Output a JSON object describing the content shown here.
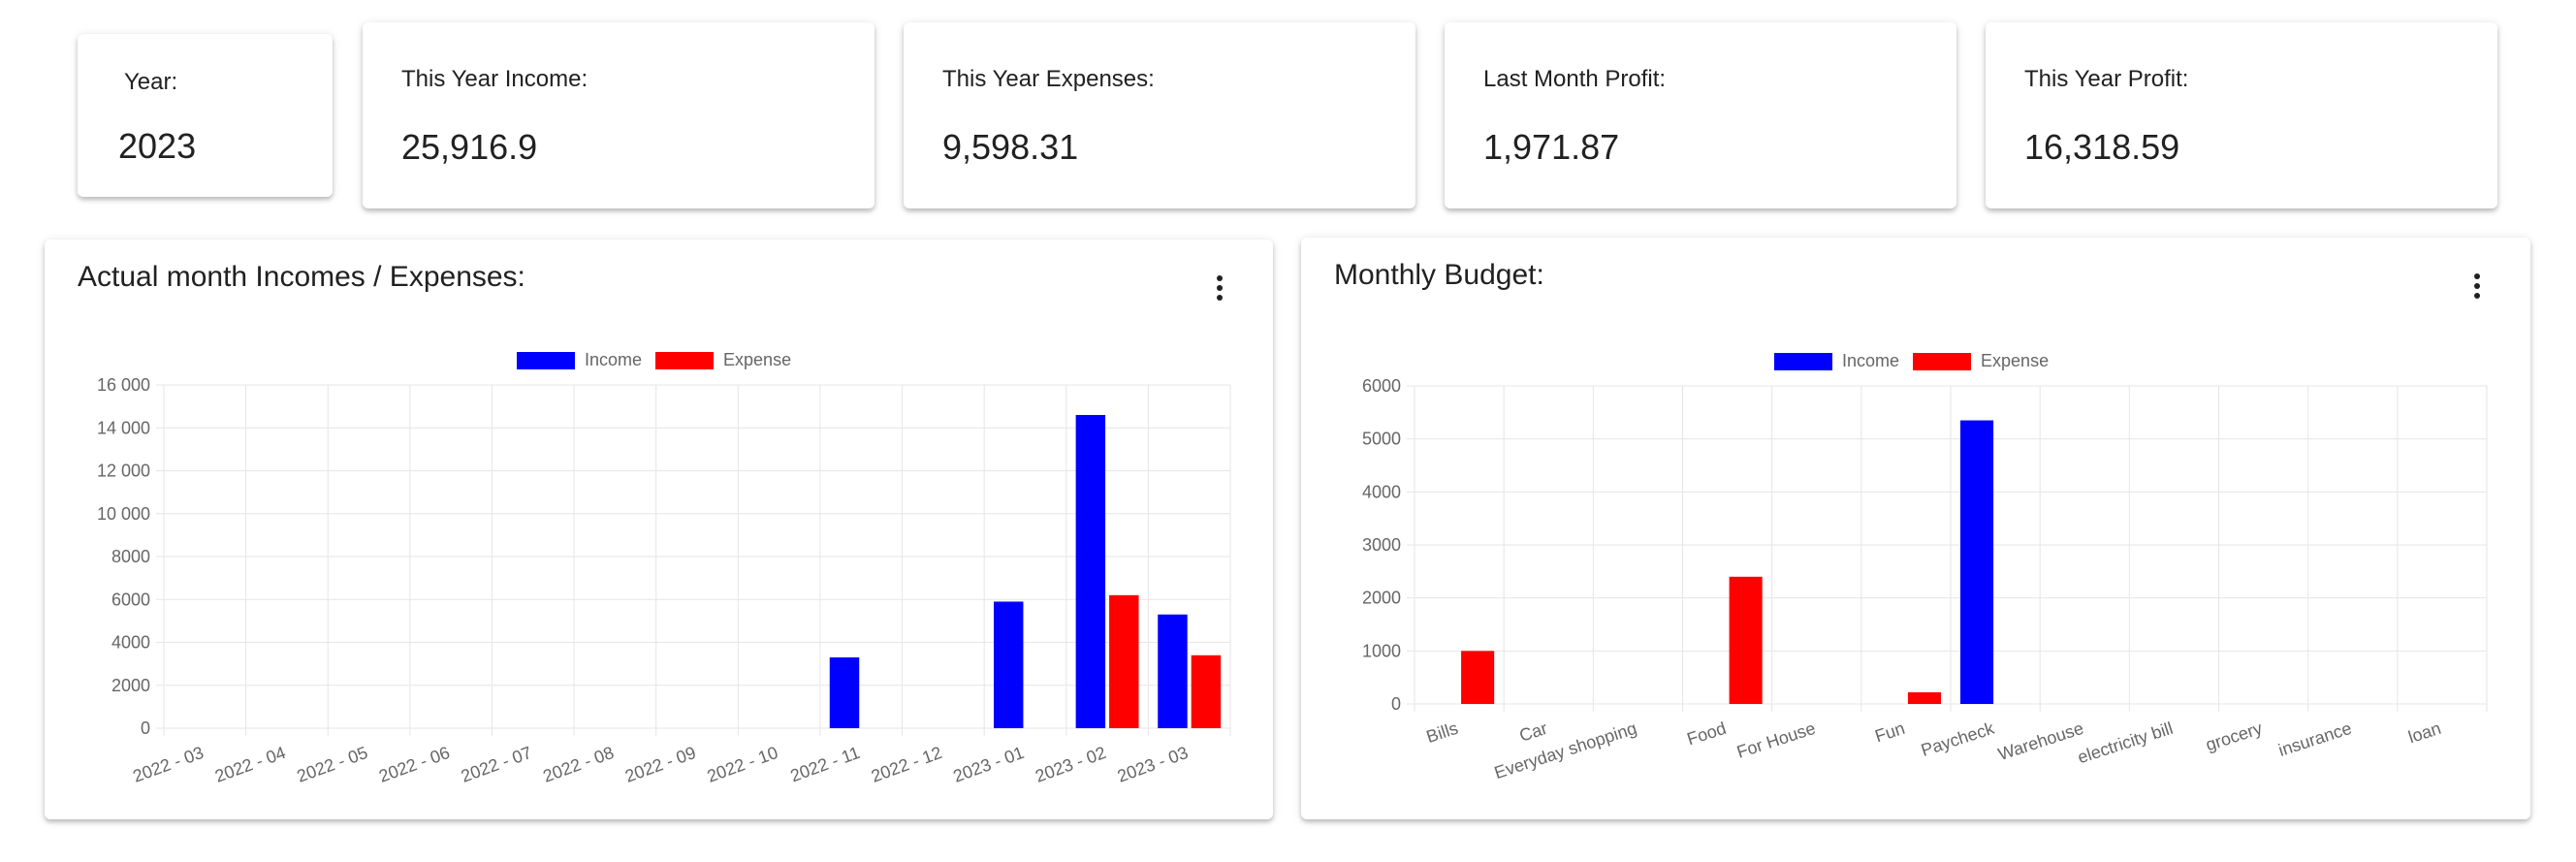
{
  "stats": {
    "year": {
      "label": "Year:",
      "value": "2023"
    },
    "income": {
      "label": "This Year Income:",
      "value": "25,916.9"
    },
    "expenses": {
      "label": "This Year Expenses:",
      "value": "9,598.31"
    },
    "last_month_profit": {
      "label": "Last Month Profit:",
      "value": "1,971.87"
    },
    "year_profit": {
      "label": "This Year Profit:",
      "value": "16,318.59"
    }
  },
  "colors": {
    "income": "#0000ff",
    "expense": "#ff0000",
    "grid": "#e6e6e6",
    "tick": "#666666"
  },
  "charts": {
    "monthly": {
      "title": "Actual month Incomes / Expenses:",
      "menu_icon": "more-vertical-icon",
      "legend": [
        "Income",
        "Expense"
      ]
    },
    "budget": {
      "title": "Monthly Budget:",
      "menu_icon": "more-vertical-icon",
      "legend": [
        "Income",
        "Expense"
      ]
    }
  },
  "chart_data": [
    {
      "type": "bar",
      "title": "Actual month Incomes / Expenses:",
      "categories": [
        "2022 - 03",
        "2022 - 04",
        "2022 - 05",
        "2022 - 06",
        "2022 - 07",
        "2022 - 08",
        "2022 - 09",
        "2022 - 10",
        "2022 - 11",
        "2022 - 12",
        "2023 - 01",
        "2023 - 02",
        "2023 - 03"
      ],
      "series": [
        {
          "name": "Income",
          "values": [
            0,
            0,
            0,
            0,
            0,
            0,
            0,
            0,
            3300,
            0,
            5900,
            14600,
            5300
          ]
        },
        {
          "name": "Expense",
          "values": [
            0,
            0,
            0,
            0,
            0,
            0,
            0,
            0,
            0,
            0,
            0,
            6200,
            3400
          ]
        }
      ],
      "yticks": [
        "0",
        "2000",
        "4000",
        "6000",
        "8000",
        "10 000",
        "12 000",
        "14 000",
        "16 000"
      ],
      "ylim": [
        0,
        16000
      ],
      "grid": true,
      "legend": "top-center"
    },
    {
      "type": "bar",
      "title": "Monthly Budget:",
      "categories": [
        "Bills",
        "Car",
        "Everyday shopping",
        "Food",
        "For House",
        "Fun",
        "Paycheck",
        "Warehouse",
        "electricity bill",
        "grocery",
        "insurance",
        "loan"
      ],
      "series": [
        {
          "name": "Income",
          "values": [
            0,
            0,
            0,
            0,
            0,
            0,
            5350,
            0,
            0,
            0,
            0,
            0
          ]
        },
        {
          "name": "Expense",
          "values": [
            1000,
            0,
            0,
            2400,
            0,
            220,
            0,
            0,
            0,
            0,
            0,
            0
          ]
        }
      ],
      "yticks": [
        "0",
        "1000",
        "2000",
        "3000",
        "4000",
        "5000",
        "6000"
      ],
      "ylim": [
        0,
        6000
      ],
      "grid": true,
      "legend": "top-center"
    }
  ]
}
